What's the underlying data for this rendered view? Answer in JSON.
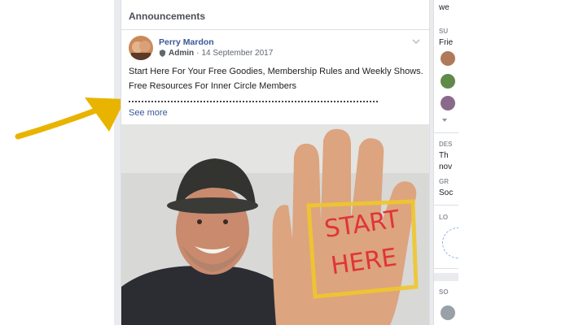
{
  "announcements": {
    "title": "Announcements"
  },
  "post": {
    "author": "Perry Mardon",
    "role": "Admin",
    "date": "14 September 2017",
    "line1": "Start Here For Your Free Goodies, Membership Rules and Weekly Shows.",
    "line2": "Free Resources For Inner Circle Members",
    "see_more": "See more",
    "image_text_top": "START",
    "image_text_bottom": "HERE"
  },
  "sidebar": {
    "t1": "we",
    "caps1": "SU",
    "t2": "Frie",
    "caps2": "DES",
    "t3": "Th",
    "t4": "nov",
    "caps3": "GR",
    "t5": "Soc",
    "caps4": "LO",
    "caps5": "SO"
  },
  "colors": {
    "link": "#385898",
    "arrow": "#e8b400",
    "frame": "#f0c62c",
    "ink": "#e0343a"
  }
}
